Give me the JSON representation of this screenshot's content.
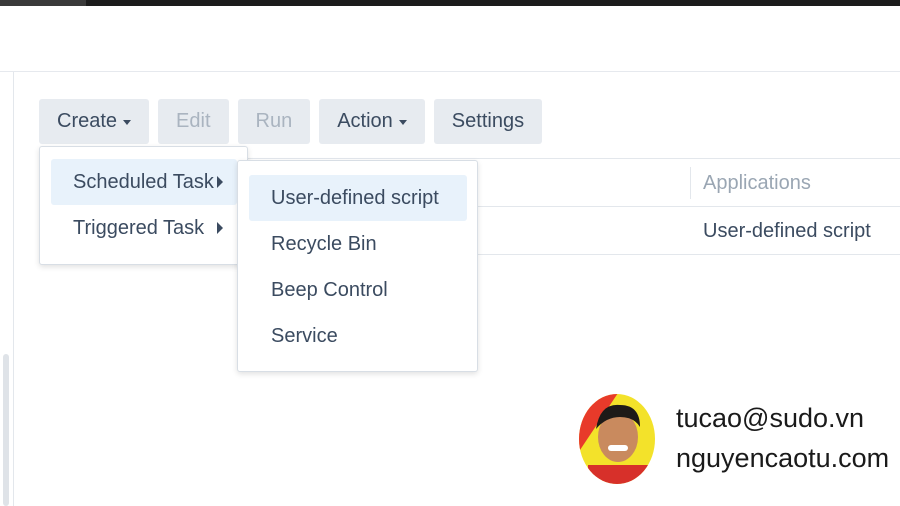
{
  "toolbar": {
    "create_label": "Create",
    "edit_label": "Edit",
    "run_label": "Run",
    "action_label": "Action",
    "settings_label": "Settings"
  },
  "grid": {
    "column_header": "Applications",
    "row_value": "User-defined script"
  },
  "create_menu": {
    "items": [
      {
        "label": "Scheduled Task"
      },
      {
        "label": "Triggered Task"
      }
    ]
  },
  "scheduled_submenu": {
    "items": [
      {
        "label": "User-defined script"
      },
      {
        "label": "Recycle Bin"
      },
      {
        "label": "Beep Control"
      },
      {
        "label": "Service"
      }
    ]
  },
  "watermark": {
    "email": "tucao@sudo.vn",
    "website": "nguyencaotu.com"
  },
  "colors": {
    "button_bg": "#e7ebf0",
    "menu_highlight": "#e8f2fb",
    "text": "#3b4b60",
    "disabled_text": "#aab4c0"
  }
}
